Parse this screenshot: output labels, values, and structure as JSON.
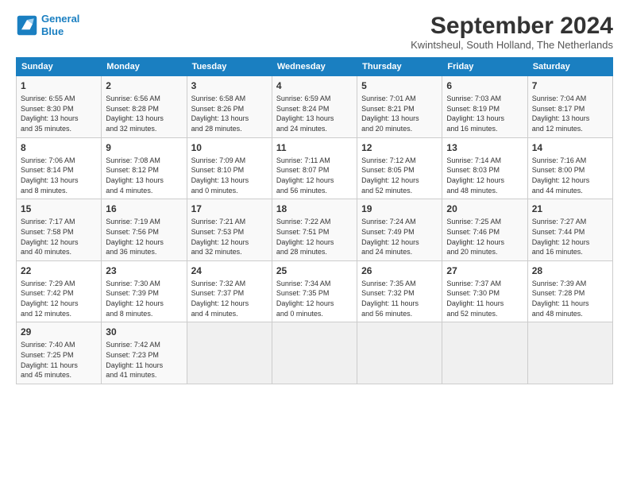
{
  "logo": {
    "line1": "General",
    "line2": "Blue"
  },
  "title": "September 2024",
  "subtitle": "Kwintsheul, South Holland, The Netherlands",
  "weekdays": [
    "Sunday",
    "Monday",
    "Tuesday",
    "Wednesday",
    "Thursday",
    "Friday",
    "Saturday"
  ],
  "weeks": [
    [
      {
        "day": "1",
        "info": "Sunrise: 6:55 AM\nSunset: 8:30 PM\nDaylight: 13 hours\nand 35 minutes."
      },
      {
        "day": "2",
        "info": "Sunrise: 6:56 AM\nSunset: 8:28 PM\nDaylight: 13 hours\nand 32 minutes."
      },
      {
        "day": "3",
        "info": "Sunrise: 6:58 AM\nSunset: 8:26 PM\nDaylight: 13 hours\nand 28 minutes."
      },
      {
        "day": "4",
        "info": "Sunrise: 6:59 AM\nSunset: 8:24 PM\nDaylight: 13 hours\nand 24 minutes."
      },
      {
        "day": "5",
        "info": "Sunrise: 7:01 AM\nSunset: 8:21 PM\nDaylight: 13 hours\nand 20 minutes."
      },
      {
        "day": "6",
        "info": "Sunrise: 7:03 AM\nSunset: 8:19 PM\nDaylight: 13 hours\nand 16 minutes."
      },
      {
        "day": "7",
        "info": "Sunrise: 7:04 AM\nSunset: 8:17 PM\nDaylight: 13 hours\nand 12 minutes."
      }
    ],
    [
      {
        "day": "8",
        "info": "Sunrise: 7:06 AM\nSunset: 8:14 PM\nDaylight: 13 hours\nand 8 minutes."
      },
      {
        "day": "9",
        "info": "Sunrise: 7:08 AM\nSunset: 8:12 PM\nDaylight: 13 hours\nand 4 minutes."
      },
      {
        "day": "10",
        "info": "Sunrise: 7:09 AM\nSunset: 8:10 PM\nDaylight: 13 hours\nand 0 minutes."
      },
      {
        "day": "11",
        "info": "Sunrise: 7:11 AM\nSunset: 8:07 PM\nDaylight: 12 hours\nand 56 minutes."
      },
      {
        "day": "12",
        "info": "Sunrise: 7:12 AM\nSunset: 8:05 PM\nDaylight: 12 hours\nand 52 minutes."
      },
      {
        "day": "13",
        "info": "Sunrise: 7:14 AM\nSunset: 8:03 PM\nDaylight: 12 hours\nand 48 minutes."
      },
      {
        "day": "14",
        "info": "Sunrise: 7:16 AM\nSunset: 8:00 PM\nDaylight: 12 hours\nand 44 minutes."
      }
    ],
    [
      {
        "day": "15",
        "info": "Sunrise: 7:17 AM\nSunset: 7:58 PM\nDaylight: 12 hours\nand 40 minutes."
      },
      {
        "day": "16",
        "info": "Sunrise: 7:19 AM\nSunset: 7:56 PM\nDaylight: 12 hours\nand 36 minutes."
      },
      {
        "day": "17",
        "info": "Sunrise: 7:21 AM\nSunset: 7:53 PM\nDaylight: 12 hours\nand 32 minutes."
      },
      {
        "day": "18",
        "info": "Sunrise: 7:22 AM\nSunset: 7:51 PM\nDaylight: 12 hours\nand 28 minutes."
      },
      {
        "day": "19",
        "info": "Sunrise: 7:24 AM\nSunset: 7:49 PM\nDaylight: 12 hours\nand 24 minutes."
      },
      {
        "day": "20",
        "info": "Sunrise: 7:25 AM\nSunset: 7:46 PM\nDaylight: 12 hours\nand 20 minutes."
      },
      {
        "day": "21",
        "info": "Sunrise: 7:27 AM\nSunset: 7:44 PM\nDaylight: 12 hours\nand 16 minutes."
      }
    ],
    [
      {
        "day": "22",
        "info": "Sunrise: 7:29 AM\nSunset: 7:42 PM\nDaylight: 12 hours\nand 12 minutes."
      },
      {
        "day": "23",
        "info": "Sunrise: 7:30 AM\nSunset: 7:39 PM\nDaylight: 12 hours\nand 8 minutes."
      },
      {
        "day": "24",
        "info": "Sunrise: 7:32 AM\nSunset: 7:37 PM\nDaylight: 12 hours\nand 4 minutes."
      },
      {
        "day": "25",
        "info": "Sunrise: 7:34 AM\nSunset: 7:35 PM\nDaylight: 12 hours\nand 0 minutes."
      },
      {
        "day": "26",
        "info": "Sunrise: 7:35 AM\nSunset: 7:32 PM\nDaylight: 11 hours\nand 56 minutes."
      },
      {
        "day": "27",
        "info": "Sunrise: 7:37 AM\nSunset: 7:30 PM\nDaylight: 11 hours\nand 52 minutes."
      },
      {
        "day": "28",
        "info": "Sunrise: 7:39 AM\nSunset: 7:28 PM\nDaylight: 11 hours\nand 48 minutes."
      }
    ],
    [
      {
        "day": "29",
        "info": "Sunrise: 7:40 AM\nSunset: 7:25 PM\nDaylight: 11 hours\nand 45 minutes."
      },
      {
        "day": "30",
        "info": "Sunrise: 7:42 AM\nSunset: 7:23 PM\nDaylight: 11 hours\nand 41 minutes."
      },
      null,
      null,
      null,
      null,
      null
    ]
  ]
}
